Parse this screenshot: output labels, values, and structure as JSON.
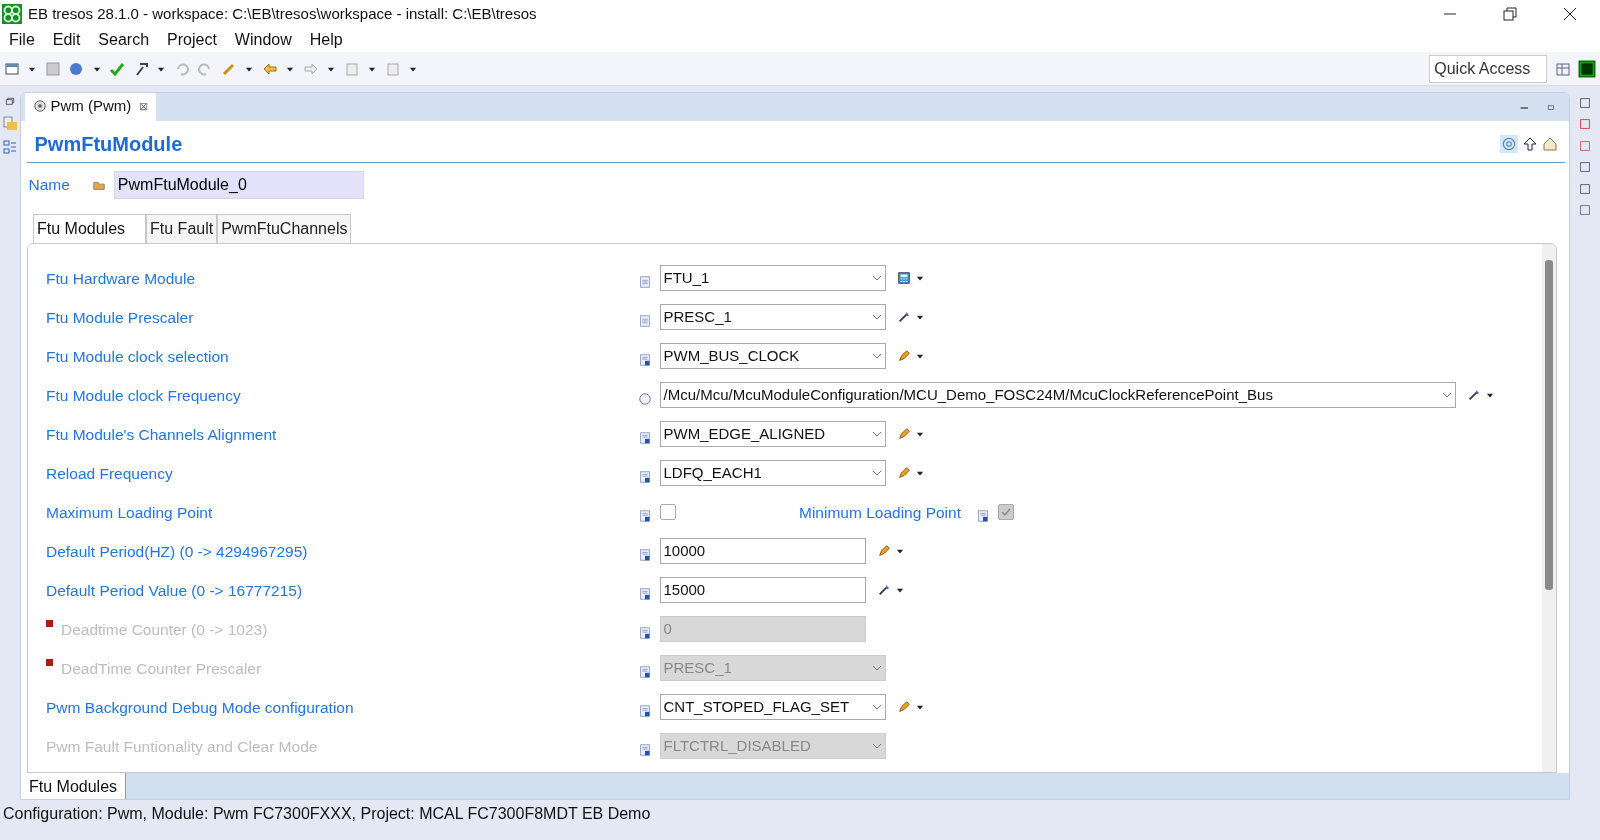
{
  "window": {
    "title": "EB tresos 28.1.0 - workspace: C:\\EB\\tresos\\workspace - install: C:\\EB\\tresos"
  },
  "menu": [
    "File",
    "Edit",
    "Search",
    "Project",
    "Window",
    "Help"
  ],
  "quick_access": {
    "placeholder": "Quick Access"
  },
  "editor_tab": {
    "label": "Pwm (Pwm)",
    "close": "⊠"
  },
  "heading": "PwmFtuModule",
  "name_field": {
    "label": "Name",
    "value": "PwmFtuModule_0"
  },
  "tabs": [
    {
      "label": "Ftu Modules",
      "selected": true
    },
    {
      "label": "Ftu Fault",
      "selected": false
    },
    {
      "label": "PwmFtuChannels",
      "selected": false
    }
  ],
  "rows": [
    {
      "kind": "combo",
      "label": "Ftu Hardware Module",
      "value": "FTU_1",
      "disabled": false,
      "wide": false,
      "marker": false
    },
    {
      "kind": "combo",
      "label": "Ftu Module Prescaler",
      "value": "PRESC_1",
      "disabled": false,
      "wide": false,
      "marker": false
    },
    {
      "kind": "combo",
      "label": "Ftu Module clock selection",
      "value": "PWM_BUS_CLOCK",
      "disabled": false,
      "wide": false,
      "marker": false
    },
    {
      "kind": "combo",
      "label": "Ftu Module clock Frequency",
      "value": "/Mcu/Mcu/McuModuleConfiguration/MCU_Demo_FOSC24M/McuClockReferencePoint_Bus",
      "disabled": false,
      "wide": true,
      "marker": false
    },
    {
      "kind": "combo",
      "label": "Ftu Module's Channels Alignment",
      "value": "PWM_EDGE_ALIGNED",
      "disabled": false,
      "wide": false,
      "marker": false
    },
    {
      "kind": "combo",
      "label": "Reload Frequency",
      "value": "LDFQ_EACH1",
      "disabled": false,
      "wide": false,
      "marker": false
    },
    {
      "kind": "checks",
      "label": "Maximum Loading Point",
      "checked": false,
      "label2": "Minimum Loading Point",
      "checked2": true,
      "disabled2": true
    },
    {
      "kind": "text",
      "label": "Default Period(HZ) (0 -> 4294967295)",
      "value": "10000",
      "disabled": false,
      "marker": false
    },
    {
      "kind": "text",
      "label": "Default Period Value (0 -> 16777215)",
      "value": "15000",
      "disabled": false,
      "marker": false
    },
    {
      "kind": "text",
      "label": "Deadtime Counter (0 -> 1023)",
      "value": "0",
      "disabled": true,
      "marker": true
    },
    {
      "kind": "combo",
      "label": "DeadTime Counter Prescaler",
      "value": "PRESC_1",
      "disabled": true,
      "wide": false,
      "marker": true
    },
    {
      "kind": "combo",
      "label": "Pwm Background Debug Mode configuration",
      "value": "CNT_STOPED_FLAG_SET",
      "disabled": false,
      "wide": false,
      "marker": false
    },
    {
      "kind": "combo",
      "label": "Pwm Fault Funtionality and Clear Mode",
      "value": "FLTCTRL_DISABLED",
      "disabled": true,
      "wide": false,
      "marker": false
    }
  ],
  "bottom_tab": "Ftu Modules",
  "status_bar": "Configuration: Pwm, Module: Pwm  FC7300FXXX, Project: MCAL  FC7300F8MDT  EB  Demo"
}
